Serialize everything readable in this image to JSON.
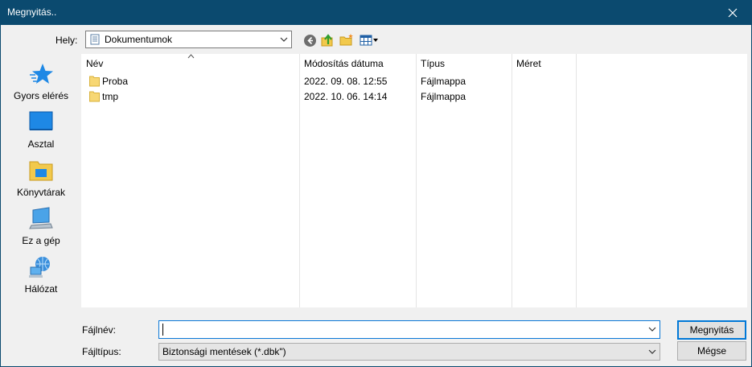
{
  "window": {
    "title": "Megnyitás.."
  },
  "location": {
    "label": "Hely:",
    "value": "Dokumentumok"
  },
  "places": [
    {
      "label": "Gyors elérés",
      "icon": "quick-access-star-icon"
    },
    {
      "label": "Asztal",
      "icon": "desktop-icon"
    },
    {
      "label": "Könyvtárak",
      "icon": "libraries-icon"
    },
    {
      "label": "Ez a gép",
      "icon": "this-pc-icon"
    },
    {
      "label": "Hálózat",
      "icon": "network-icon"
    }
  ],
  "columns": {
    "name": "Név",
    "modified": "Módosítás dátuma",
    "type": "Típus",
    "size": "Méret"
  },
  "files": [
    {
      "name": "Proba",
      "modified": "2022. 09. 08. 12:55",
      "type": "Fájlmappa",
      "size": ""
    },
    {
      "name": "tmp",
      "modified": "2022. 10. 06. 14:14",
      "type": "Fájlmappa",
      "size": ""
    }
  ],
  "filename": {
    "label": "Fájlnév:",
    "value": ""
  },
  "filetype": {
    "label": "Fájltípus:",
    "value": "Biztonsági mentések (*.dbk\")"
  },
  "buttons": {
    "open": "Megnyitás",
    "cancel": "Mégse"
  },
  "colors": {
    "titlebar": "#0b4a6f",
    "focus": "#0078d7",
    "folder": "#f7d774"
  }
}
